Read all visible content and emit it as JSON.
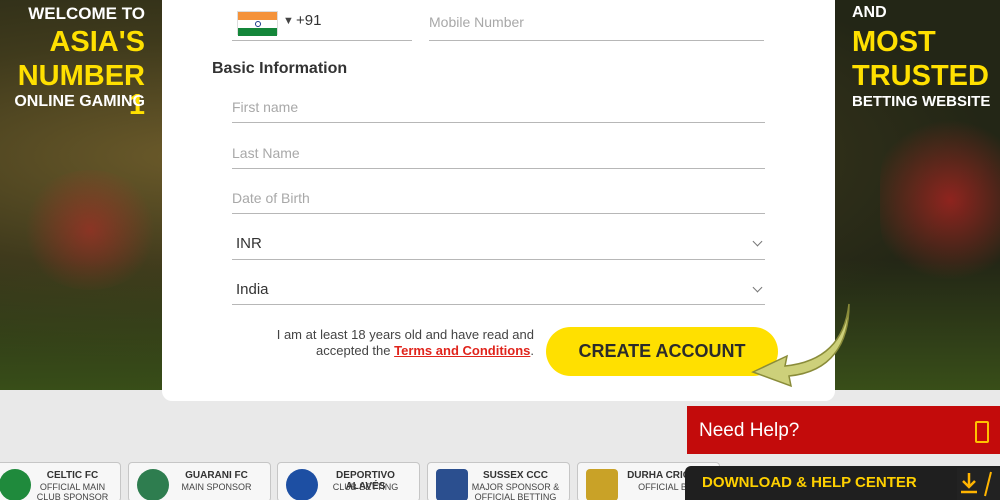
{
  "promo": {
    "left": [
      "WELCOME TO",
      "ASIA'S",
      "NUMBER 1",
      "ONLINE GAMING"
    ],
    "right": [
      "AND",
      "MOST",
      "TRUSTED",
      "BETTING WEBSITE"
    ]
  },
  "form": {
    "phone": {
      "country_flag": "india-flag",
      "dial_code": "+91",
      "mobile_placeholder": "Mobile Number"
    },
    "section_title": "Basic Information",
    "first_name_placeholder": "First name",
    "last_name_placeholder": "Last Name",
    "dob_placeholder": "Date of Birth",
    "currency_value": "INR",
    "country_value": "India",
    "terms": {
      "prefix": "I am at least 18 years old and have read and accepted the",
      "link": "Terms and Conditions",
      "suffix": "."
    },
    "submit_label": "CREATE ACCOUNT"
  },
  "help": {
    "label": "Need Help?"
  },
  "download": {
    "label": "DOWNLOAD & HELP CENTER"
  },
  "sponsors": [
    {
      "name": "CELTIC FC",
      "role": "OFFICIAL MAIN CLUB SPONSOR",
      "logo_color": "#1f8a3c"
    },
    {
      "name": "GUARANI FC",
      "role": "MAIN SPONSOR",
      "logo_color": "#2e7d4f"
    },
    {
      "name": "DEPORTIVO ALAVÉS",
      "role": "CLUB BETTING",
      "logo_color": "#1d4fa3"
    },
    {
      "name": "SUSSEX CCC",
      "role": "MAJOR SPONSOR & OFFICIAL BETTING",
      "logo_color": "#2b4f8f"
    },
    {
      "name": "DURHA CRICKE",
      "role": "OFFICIAL BE",
      "logo_color": "#c9a227"
    }
  ],
  "colors": {
    "accent_yellow": "#ffe000",
    "help_red": "#c30b0b",
    "terms_link_red": "#e0241c"
  }
}
